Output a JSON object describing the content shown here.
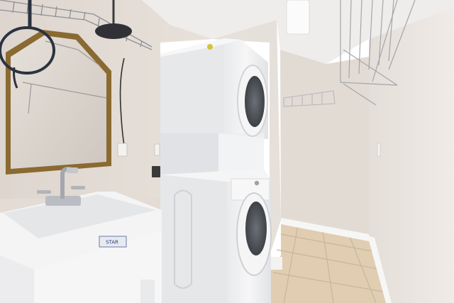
{
  "scene": {
    "type": "photo",
    "colors": {
      "wall_left": "#e6dfd8",
      "wall_back": "#e2dbd4",
      "wall_right": "#ebe6e1",
      "ceiling": "#efedeb",
      "floor": "#e0cdb2",
      "grout": "#c8b69c",
      "appliance_white": "#f3f3f4",
      "appliance_shadow": "#d9dadd",
      "door_glass": "#4b4f55",
      "mirror_frame": "#8a6a32",
      "mirror_glass": "#d9d3cd",
      "magnifier_frame": "#2b3340",
      "faucet": "#b9bcc2",
      "baseboard": "#f6f6f5"
    },
    "sink_label": "STAR"
  }
}
